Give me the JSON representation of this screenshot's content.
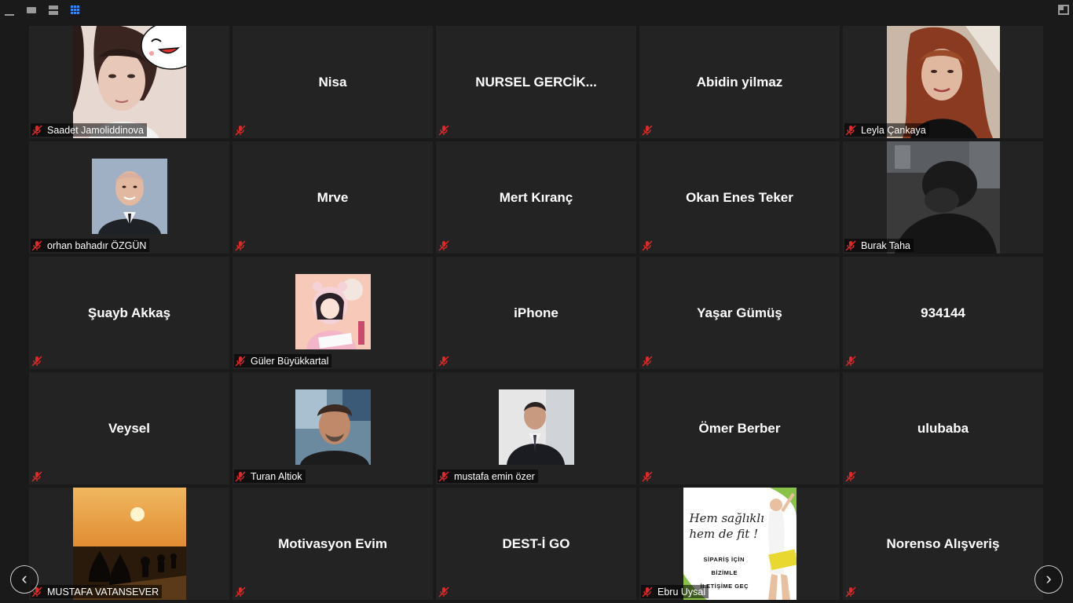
{
  "toolbar": {
    "icons": [
      "minimize-icon",
      "speaker-view-icon",
      "filmstrip-icon",
      "gallery-view-icon",
      "exit-fullscreen-icon"
    ],
    "active_color": "#2d8cff"
  },
  "navigation": {
    "prev_glyph": "‹",
    "next_glyph": "›"
  },
  "colors": {
    "mute_red": "#e02828",
    "tile_bg": "#232323",
    "page_bg": "#1a1a1a"
  },
  "participants": [
    {
      "id": "p1",
      "name": "Saadet Jamoliddinova",
      "muted": true,
      "video": "photo"
    },
    {
      "id": "p2",
      "name": "Nisa",
      "muted": true,
      "video": "off"
    },
    {
      "id": "p3",
      "name": "NURSEL  GERCİK...",
      "muted": true,
      "video": "off"
    },
    {
      "id": "p4",
      "name": "Abidin yilmaz",
      "muted": true,
      "video": "off"
    },
    {
      "id": "p5",
      "name": "Leyla Çankaya",
      "muted": true,
      "video": "photo"
    },
    {
      "id": "p6",
      "name": "orhan bahadır ÖZGÜN",
      "muted": true,
      "video": "avatar"
    },
    {
      "id": "p7",
      "name": "Mrve",
      "muted": true,
      "video": "off"
    },
    {
      "id": "p8",
      "name": "Mert Kıranç",
      "muted": true,
      "video": "off"
    },
    {
      "id": "p9",
      "name": "Okan Enes Teker",
      "muted": true,
      "video": "off"
    },
    {
      "id": "p10",
      "name": "Burak Taha",
      "muted": true,
      "video": "photo"
    },
    {
      "id": "p11",
      "name": "Şuayb Akkaş",
      "muted": true,
      "video": "off"
    },
    {
      "id": "p12",
      "name": "Güler Büyükkartal",
      "muted": true,
      "video": "avatar"
    },
    {
      "id": "p13",
      "name": "iPhone",
      "muted": true,
      "video": "off"
    },
    {
      "id": "p14",
      "name": "Yaşar Gümüş",
      "muted": true,
      "video": "off"
    },
    {
      "id": "p15",
      "name": "934144",
      "muted": true,
      "video": "off"
    },
    {
      "id": "p16",
      "name": "Veysel",
      "muted": true,
      "video": "off"
    },
    {
      "id": "p17",
      "name": "Turan Altiok",
      "muted": true,
      "video": "avatar"
    },
    {
      "id": "p18",
      "name": "mustafa emin özer",
      "muted": true,
      "video": "avatar"
    },
    {
      "id": "p19",
      "name": "Ömer Berber",
      "muted": true,
      "video": "off"
    },
    {
      "id": "p20",
      "name": "ulubaba",
      "muted": true,
      "video": "off"
    },
    {
      "id": "p21",
      "name": "MUSTAFA VATANSEVER",
      "muted": true,
      "video": "photo"
    },
    {
      "id": "p22",
      "name": "Motivasyon Evim",
      "muted": true,
      "video": "off"
    },
    {
      "id": "p23",
      "name": "DEST-İ GO",
      "muted": true,
      "video": "off"
    },
    {
      "id": "p24",
      "name": "Ebru Uysal",
      "muted": true,
      "video": "photo"
    },
    {
      "id": "p25",
      "name": "Norenso Alışveriş",
      "muted": true,
      "video": "off"
    }
  ],
  "promo": {
    "line1": "Hem sağlıklı",
    "line2": "hem de fit !",
    "cta1": "SİPARİŞ İÇİN",
    "cta2": "BİZİMLE",
    "cta3": "İLETİŞİME GEÇ"
  }
}
